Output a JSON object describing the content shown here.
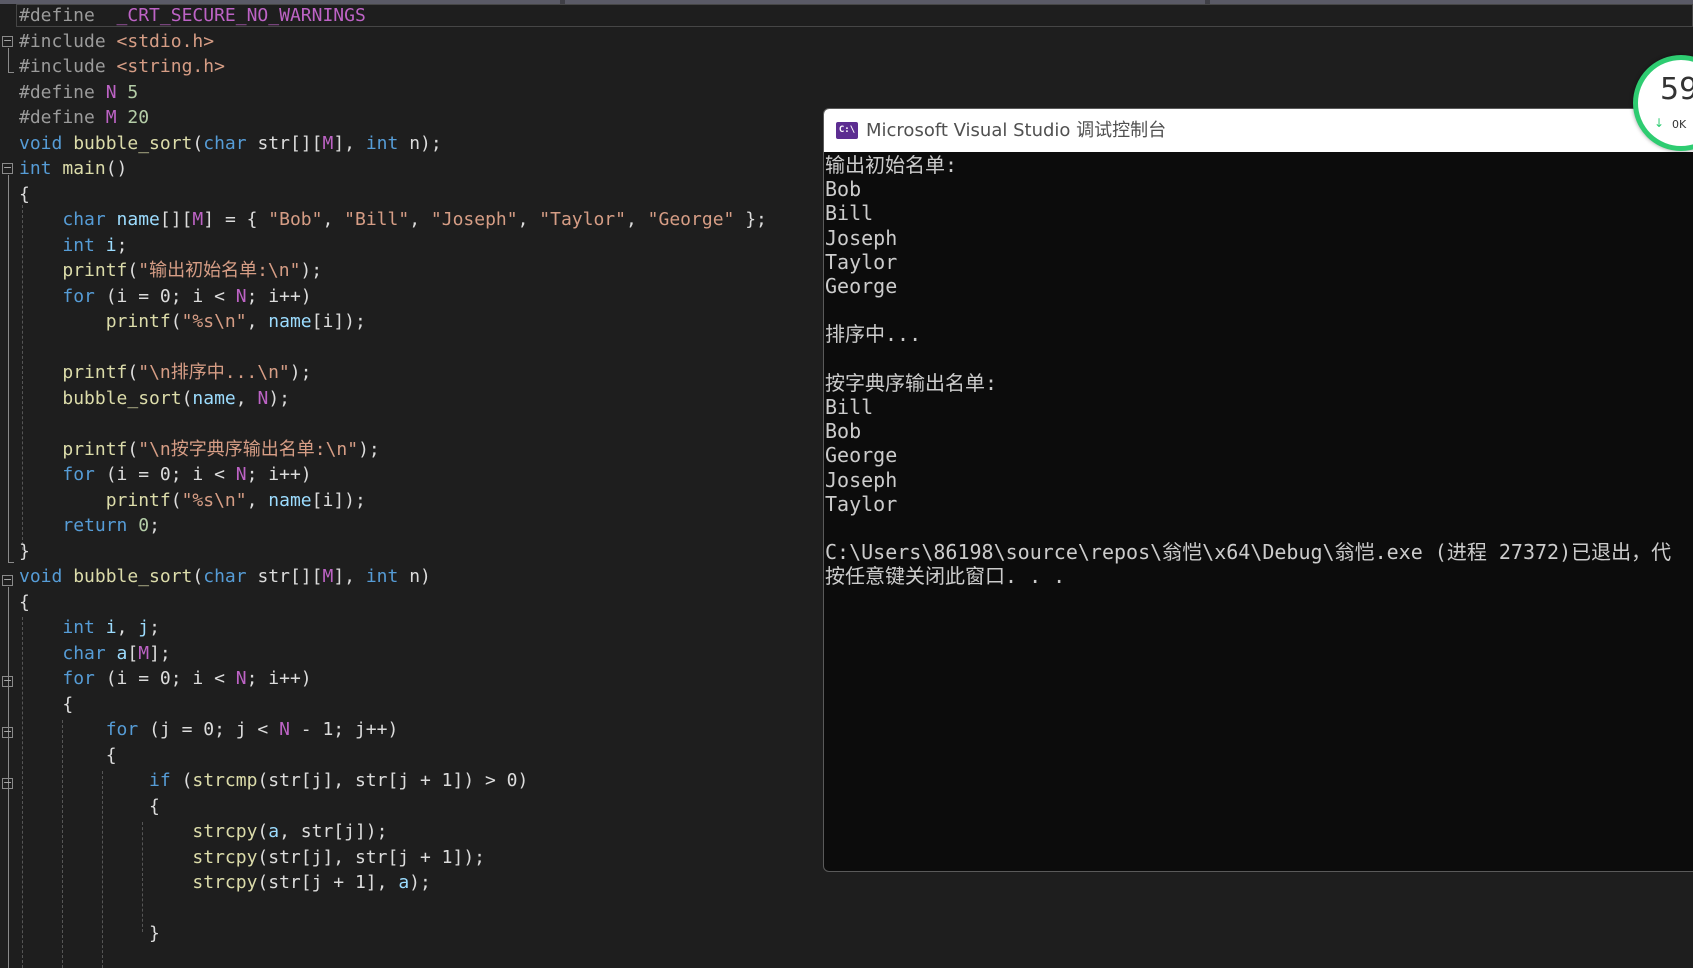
{
  "editor": {
    "lines": [
      [
        [
          "pp",
          "#define  "
        ],
        [
          "m",
          "_CRT_SECURE_NO_WARNINGS"
        ]
      ],
      [
        [
          "pp",
          "#include "
        ],
        [
          "s",
          "<stdio.h>"
        ]
      ],
      [
        [
          "pp",
          "#include "
        ],
        [
          "s",
          "<string.h>"
        ]
      ],
      [
        [
          "pp",
          "#define "
        ],
        [
          "m",
          "N"
        ],
        [
          "t",
          " "
        ],
        [
          "n",
          "5"
        ]
      ],
      [
        [
          "pp",
          "#define "
        ],
        [
          "m",
          "M"
        ],
        [
          "t",
          " "
        ],
        [
          "n",
          "20"
        ]
      ],
      [
        [
          "k",
          "void "
        ],
        [
          "f",
          "bubble_sort"
        ],
        [
          "t",
          "("
        ],
        [
          "k",
          "char "
        ],
        [
          "t",
          "str[]["
        ],
        [
          "m",
          "M"
        ],
        [
          "t",
          "], "
        ],
        [
          "k",
          "int "
        ],
        [
          "t",
          "n);"
        ]
      ],
      [
        [
          "k",
          "int "
        ],
        [
          "f",
          "main"
        ],
        [
          "t",
          "()"
        ]
      ],
      [
        [
          "t",
          "{"
        ]
      ],
      [
        [
          "t",
          "    "
        ],
        [
          "k",
          "char "
        ],
        [
          "v",
          "name"
        ],
        [
          "t",
          "[]["
        ],
        [
          "m",
          "M"
        ],
        [
          "t",
          "] = { "
        ],
        [
          "s",
          "\"Bob\""
        ],
        [
          "t",
          ", "
        ],
        [
          "s",
          "\"Bill\""
        ],
        [
          "t",
          ", "
        ],
        [
          "s",
          "\"Joseph\""
        ],
        [
          "t",
          ", "
        ],
        [
          "s",
          "\"Taylor\""
        ],
        [
          "t",
          ", "
        ],
        [
          "s",
          "\"George\""
        ],
        [
          "t",
          " };"
        ]
      ],
      [
        [
          "t",
          "    "
        ],
        [
          "k",
          "int "
        ],
        [
          "v",
          "i"
        ],
        [
          "t",
          ";"
        ]
      ],
      [
        [
          "t",
          "    "
        ],
        [
          "f",
          "printf"
        ],
        [
          "t",
          "("
        ],
        [
          "s",
          "\"输出初始名单:\\n\""
        ],
        [
          "t",
          ");"
        ]
      ],
      [
        [
          "t",
          "    "
        ],
        [
          "k",
          "for "
        ],
        [
          "t",
          "(i = 0; i < "
        ],
        [
          "m",
          "N"
        ],
        [
          "t",
          "; i++)"
        ]
      ],
      [
        [
          "t",
          "        "
        ],
        [
          "f",
          "printf"
        ],
        [
          "t",
          "("
        ],
        [
          "s",
          "\"%s\\n\""
        ],
        [
          "t",
          ", "
        ],
        [
          "v",
          "name"
        ],
        [
          "t",
          "[i]);"
        ]
      ],
      [],
      [
        [
          "t",
          "    "
        ],
        [
          "f",
          "printf"
        ],
        [
          "t",
          "("
        ],
        [
          "s",
          "\"\\n排序中...\\n\""
        ],
        [
          "t",
          ");"
        ]
      ],
      [
        [
          "t",
          "    "
        ],
        [
          "f",
          "bubble_sort"
        ],
        [
          "t",
          "("
        ],
        [
          "v",
          "name"
        ],
        [
          "t",
          ", "
        ],
        [
          "m",
          "N"
        ],
        [
          "t",
          ");"
        ]
      ],
      [],
      [
        [
          "t",
          "    "
        ],
        [
          "f",
          "printf"
        ],
        [
          "t",
          "("
        ],
        [
          "s",
          "\"\\n按字典序输出名单:\\n\""
        ],
        [
          "t",
          ");"
        ]
      ],
      [
        [
          "t",
          "    "
        ],
        [
          "k",
          "for "
        ],
        [
          "t",
          "(i = 0; i < "
        ],
        [
          "m",
          "N"
        ],
        [
          "t",
          "; i++)"
        ]
      ],
      [
        [
          "t",
          "        "
        ],
        [
          "f",
          "printf"
        ],
        [
          "t",
          "("
        ],
        [
          "s",
          "\"%s\\n\""
        ],
        [
          "t",
          ", "
        ],
        [
          "v",
          "name"
        ],
        [
          "t",
          "[i]);"
        ]
      ],
      [
        [
          "t",
          "    "
        ],
        [
          "k",
          "return "
        ],
        [
          "n",
          "0"
        ],
        [
          "t",
          ";"
        ]
      ],
      [
        [
          "t",
          "}"
        ]
      ],
      [
        [
          "k",
          "void "
        ],
        [
          "f",
          "bubble_sort"
        ],
        [
          "t",
          "("
        ],
        [
          "k",
          "char "
        ],
        [
          "t",
          "str[]["
        ],
        [
          "m",
          "M"
        ],
        [
          "t",
          "], "
        ],
        [
          "k",
          "int "
        ],
        [
          "t",
          "n)"
        ]
      ],
      [
        [
          "t",
          "{"
        ]
      ],
      [
        [
          "t",
          "    "
        ],
        [
          "k",
          "int "
        ],
        [
          "v",
          "i"
        ],
        [
          "t",
          ", "
        ],
        [
          "v",
          "j"
        ],
        [
          "t",
          ";"
        ]
      ],
      [
        [
          "t",
          "    "
        ],
        [
          "k",
          "char "
        ],
        [
          "v",
          "a"
        ],
        [
          "t",
          "["
        ],
        [
          "m",
          "M"
        ],
        [
          "t",
          "];"
        ]
      ],
      [
        [
          "t",
          "    "
        ],
        [
          "k",
          "for "
        ],
        [
          "t",
          "(i = 0; i < "
        ],
        [
          "m",
          "N"
        ],
        [
          "t",
          "; i++)"
        ]
      ],
      [
        [
          "t",
          "    {"
        ]
      ],
      [
        [
          "t",
          "        "
        ],
        [
          "k",
          "for "
        ],
        [
          "t",
          "(j = 0; j < "
        ],
        [
          "m",
          "N"
        ],
        [
          "t",
          " - 1; j++)"
        ]
      ],
      [
        [
          "t",
          "        {"
        ]
      ],
      [
        [
          "t",
          "            "
        ],
        [
          "k",
          "if "
        ],
        [
          "t",
          "("
        ],
        [
          "f",
          "strcmp"
        ],
        [
          "t",
          "(str[j], str[j + 1]) > 0)"
        ]
      ],
      [
        [
          "t",
          "            {"
        ]
      ],
      [
        [
          "t",
          "                "
        ],
        [
          "f",
          "strcpy"
        ],
        [
          "t",
          "("
        ],
        [
          "v",
          "a"
        ],
        [
          "t",
          ", str[j]);"
        ]
      ],
      [
        [
          "t",
          "                "
        ],
        [
          "f",
          "strcpy"
        ],
        [
          "t",
          "(str[j], str[j + 1]);"
        ]
      ],
      [
        [
          "t",
          "                "
        ],
        [
          "f",
          "strcpy"
        ],
        [
          "t",
          "(str[j + 1], "
        ],
        [
          "v",
          "a"
        ],
        [
          "t",
          ");"
        ]
      ],
      [],
      [
        [
          "t",
          "            }"
        ]
      ]
    ]
  },
  "console": {
    "title": "Microsoft Visual Studio 调试控制台",
    "icon_label": "C:\\",
    "lines": [
      "输出初始名单:",
      "Bob",
      "Bill",
      "Joseph",
      "Taylor",
      "George",
      "",
      "排序中...",
      "",
      "按字典序输出名单:",
      "Bill",
      "Bob",
      "George",
      "Joseph",
      "Taylor",
      "",
      "C:\\Users\\86198\\source\\repos\\翁恺\\x64\\Debug\\翁恺.exe (进程 27372)已退出，代",
      "按任意键关闭此窗口. . ."
    ]
  },
  "speed_widget": {
    "value": "59",
    "arrow": "↓",
    "unit": "0K"
  },
  "colors": {
    "editor_bg": "#1e1e1e",
    "console_bg": "#0c0c0c",
    "keyword": "#569cd6",
    "string": "#d69d85",
    "function": "#dcdcaa",
    "macro": "#bd63c5",
    "widget_ring": "#2ecc71"
  }
}
